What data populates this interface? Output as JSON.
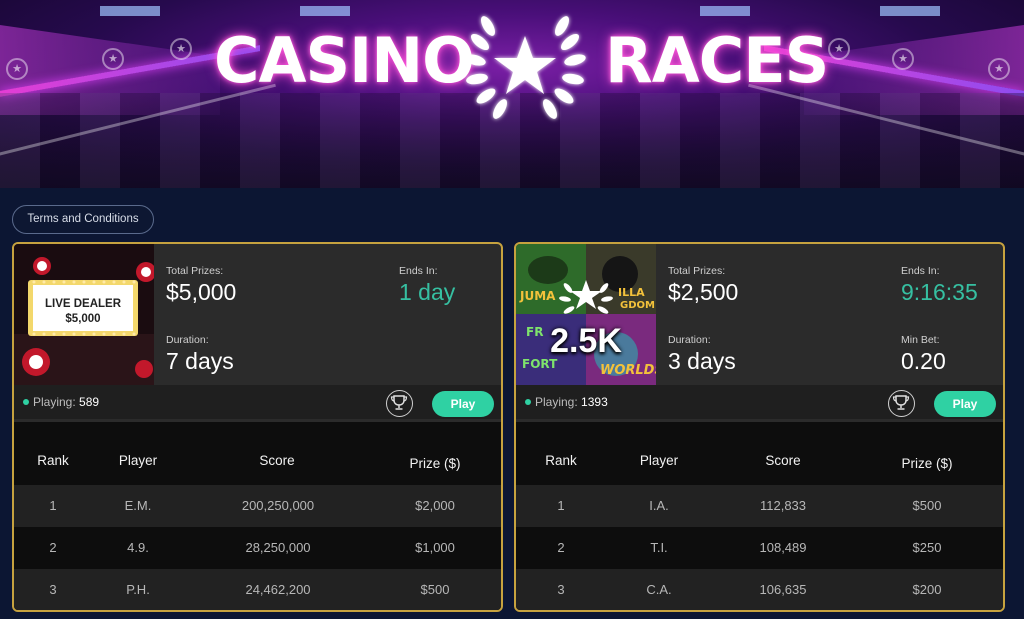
{
  "hero": {
    "title_left": "CASINO",
    "title_right": "RACES"
  },
  "terms_label": "Terms and Conditions",
  "cards": [
    {
      "thumb_line1": "LIVE DEALER",
      "thumb_line2": "$5,000",
      "total_prizes_label": "Total Prizes:",
      "total_prizes": "$5,000",
      "ends_label": "Ends In:",
      "ends_value": "1 day",
      "duration_label": "Duration:",
      "duration": "7 days",
      "playing_label": "Playing:",
      "playing_count": "589",
      "play_label": "Play",
      "headers": [
        "Rank",
        "Player",
        "Score",
        "Prize ($)"
      ],
      "rows": [
        [
          "1",
          "E.M.",
          "200,250,000",
          "$2,000"
        ],
        [
          "2",
          "4.9.",
          "28,250,000",
          "$1,000"
        ],
        [
          "3",
          "P.H.",
          "24,462,200",
          "$500"
        ]
      ]
    },
    {
      "thumb_text": "2.5K",
      "thumb_games": [
        "JUMA",
        "JILLA DOM",
        "FR FORT",
        "WORLDS"
      ],
      "total_prizes_label": "Total Prizes:",
      "total_prizes": "$2,500",
      "ends_label": "Ends In:",
      "ends_value": "9:16:35",
      "duration_label": "Duration:",
      "duration": "3 days",
      "minbet_label": "Min Bet:",
      "minbet": "0.20",
      "playing_label": "Playing:",
      "playing_count": "1393",
      "play_label": "Play",
      "headers": [
        "Rank",
        "Player",
        "Score",
        "Prize ($)"
      ],
      "rows": [
        [
          "1",
          "I.A.",
          "112,833",
          "$500"
        ],
        [
          "2",
          "T.I.",
          "108,489",
          "$250"
        ],
        [
          "3",
          "C.A.",
          "106,635",
          "$200"
        ]
      ]
    }
  ],
  "colors": {
    "accent_green": "#2fd1a3",
    "card_border": "#c6a23f",
    "hero_glow": "#ff4fd8"
  }
}
